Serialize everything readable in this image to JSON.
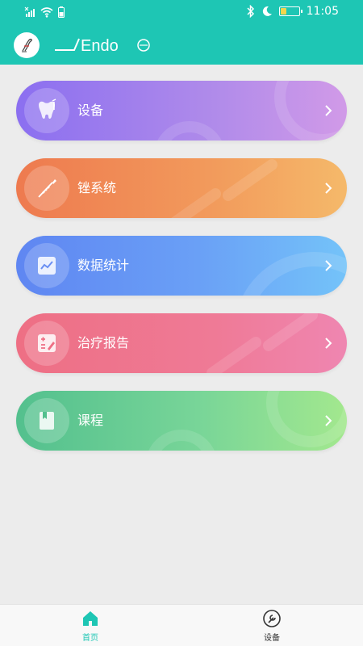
{
  "status_bar": {
    "time": "11:05",
    "battery_level": 0.3,
    "icons": [
      "no-sim-icon",
      "wifi-icon",
      "charging-icon",
      "bluetooth-icon",
      "moon-icon",
      "battery-icon"
    ]
  },
  "app_bar": {
    "logo_text": "Endo",
    "avatar_icon": "bird-avatar-icon"
  },
  "menu": [
    {
      "label": "设备",
      "icon": "tooth-icon"
    },
    {
      "label": "锉系统",
      "icon": "file-needle-icon"
    },
    {
      "label": "数据统计",
      "icon": "chart-icon"
    },
    {
      "label": "治疗报告",
      "icon": "report-icon"
    },
    {
      "label": "课程",
      "icon": "book-icon"
    }
  ],
  "colors": {
    "primary": "#1ec6b4",
    "card_device": "#8b6ff0",
    "card_files": "#ee7a4f",
    "card_stats": "#5f86f2",
    "card_report": "#ee6f84",
    "card_course": "#53c08e"
  },
  "tab_bar": {
    "tabs": [
      {
        "label": "首页",
        "icon": "home-icon",
        "active": true
      },
      {
        "label": "设备",
        "icon": "device-wrench-icon",
        "active": false
      }
    ]
  }
}
